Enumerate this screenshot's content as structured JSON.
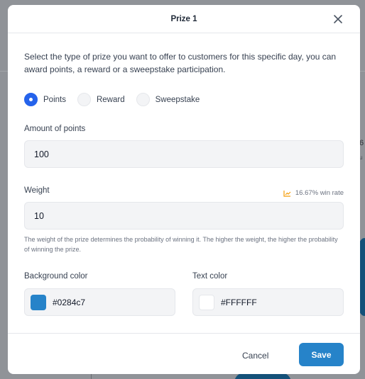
{
  "background": {
    "partial_number": "6",
    "partial_sub": "u"
  },
  "modal": {
    "title": "Prize 1",
    "description": "Select the type of prize you want to offer to customers for this specific day, you can award points, a reward or a sweepstake participation.",
    "prize_types": [
      {
        "label": "Points",
        "checked": true
      },
      {
        "label": "Reward",
        "checked": false
      },
      {
        "label": "Sweepstake",
        "checked": false
      }
    ],
    "points": {
      "label": "Amount of points",
      "value": "100"
    },
    "weight": {
      "label": "Weight",
      "value": "10",
      "win_rate": "16.67% win rate",
      "help": "The weight of the prize determines the probability of winning it. The higher the weight, the higher the probability of winning the prize."
    },
    "background_color": {
      "label": "Background color",
      "value": "#0284c7",
      "swatch": "#2683c9"
    },
    "text_color": {
      "label": "Text color",
      "value": "#FFFFFF",
      "swatch": "#ffffff"
    },
    "buttons": {
      "cancel": "Cancel",
      "save": "Save"
    },
    "colors": {
      "accent": "#2563eb",
      "save_button": "#2683c9",
      "win_rate_icon": "#f59e0b"
    }
  }
}
